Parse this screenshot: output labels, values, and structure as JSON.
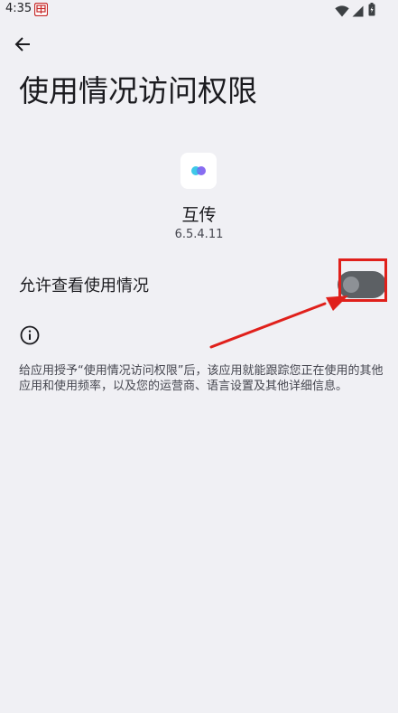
{
  "status_bar": {
    "time": "4:35",
    "notification_icon": "app-notification-icon",
    "wifi_icon": "wifi-icon",
    "signal_icon": "signal-icon",
    "battery_icon": "battery-icon"
  },
  "header": {
    "back_icon": "arrow-back-icon",
    "title": "使用情况访问权限"
  },
  "app": {
    "icon": "app-logo-icon",
    "name": "互传",
    "version": "6.5.4.11"
  },
  "permission": {
    "label": "允许查看使用情况",
    "enabled": false
  },
  "info": {
    "icon": "info-icon",
    "description": "给应用授予“使用情况访问权限”后，该应用就能跟踪您正在使用的其他应用和使用频率，以及您的运营商、语言设置及其他详细信息。"
  },
  "colors": {
    "background": "#f0f0f4",
    "toggle_track_off": "#5c6064",
    "annotation_red": "#e0201b"
  }
}
